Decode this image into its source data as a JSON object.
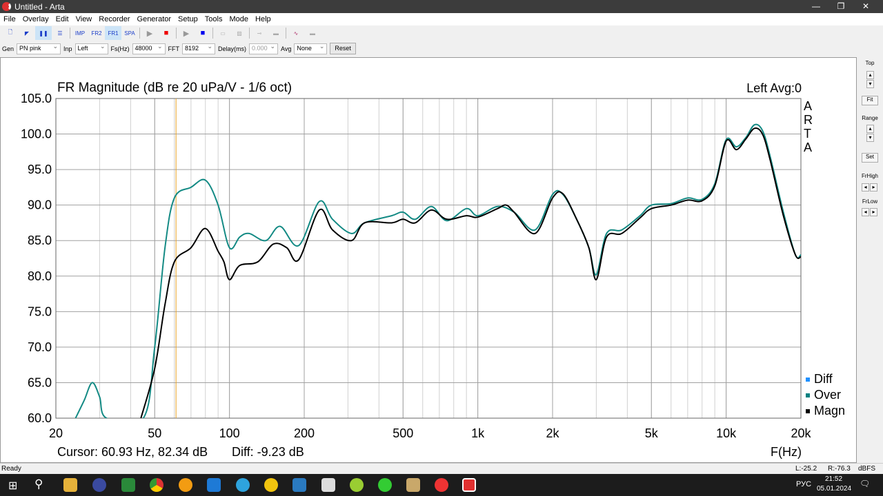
{
  "window": {
    "title": "Untitled - Arta",
    "minimize": "—",
    "maximize": "❐",
    "close": "✕"
  },
  "menu": [
    "File",
    "Overlay",
    "Edit",
    "View",
    "Recorder",
    "Generator",
    "Setup",
    "Tools",
    "Mode",
    "Help"
  ],
  "toolbar": {
    "imp": "IMP",
    "fr2": "FR2",
    "fr1": "FR1",
    "spa": "SPA"
  },
  "params": {
    "gen_label": "Gen",
    "gen": "PN pink",
    "inp_label": "Inp",
    "inp": "Left",
    "fs_label": "Fs(Hz)",
    "fs": "48000",
    "fft_label": "FFT",
    "fft": "8192",
    "delay_label": "Delay(ms)",
    "delay": "0.000",
    "avg_label": "Avg",
    "avg": "None",
    "reset": "Reset"
  },
  "right_panel": {
    "top": "Top",
    "fit": "Fit",
    "range": "Range",
    "set": "Set",
    "frhigh": "FrHigh",
    "frlow": "FrLow"
  },
  "chart_data": {
    "type": "line",
    "title": "FR Magnitude (dB re 20 uPa/V - 1/6 oct)",
    "channel_info": "Left  Avg:0",
    "watermark": "ARTA",
    "xlabel": "F(Hz)",
    "xscale": "log",
    "xlim": [
      20,
      20000
    ],
    "xticks": [
      20,
      50,
      100,
      200,
      500,
      1000,
      2000,
      5000,
      10000,
      20000
    ],
    "xtick_labels": [
      "20",
      "50",
      "100",
      "200",
      "500",
      "1k",
      "2k",
      "5k",
      "10k",
      "20k"
    ],
    "ylim": [
      60,
      105
    ],
    "yticks": [
      "105.0",
      "100.0",
      "95.0",
      "90.0",
      "85.0",
      "80.0",
      "75.0",
      "70.0",
      "65.0",
      "60.0"
    ],
    "grid": true,
    "legend": [
      {
        "name": "Diff",
        "color": "#1e90ff"
      },
      {
        "name": "Over",
        "color": "#008080"
      },
      {
        "name": "Magn",
        "color": "#000000"
      }
    ],
    "legend_position": "bottom-right",
    "cursor_freq": 60.93,
    "cursor_text": "Cursor: 60.93 Hz, 82.34 dB",
    "diff_text": "Diff: -9.23 dB",
    "series": [
      {
        "name": "Over",
        "color": "#138a84",
        "x": [
          24,
          26,
          28,
          30,
          32,
          45,
          50,
          55,
          60,
          70,
          80,
          90,
          100,
          110,
          120,
          140,
          160,
          190,
          230,
          260,
          310,
          350,
          450,
          500,
          560,
          650,
          750,
          900,
          1000,
          1200,
          1400,
          1700,
          2000,
          2200,
          2500,
          2800,
          3000,
          3300,
          3800,
          4500,
          5000,
          6000,
          7000,
          8000,
          9000,
          10000,
          11000,
          12000,
          13000,
          14000,
          15000,
          17000,
          19000,
          20000
        ],
        "y": [
          60,
          62.5,
          65,
          63,
          60,
          60,
          70,
          84,
          91,
          92.5,
          93.5,
          90,
          84,
          85.5,
          86,
          85,
          87,
          84.3,
          90.5,
          88,
          86,
          87.5,
          88.5,
          89,
          88,
          89.8,
          87.8,
          89.5,
          88.5,
          89.8,
          89,
          86.5,
          91.5,
          91.5,
          88,
          84,
          80.2,
          86,
          86.5,
          88.5,
          90,
          90.2,
          91,
          90.8,
          93,
          99.2,
          98.2,
          99.5,
          101.3,
          100.5,
          97,
          89,
          83,
          83
        ]
      },
      {
        "name": "Magn",
        "color": "#000000",
        "x": [
          44,
          50,
          55,
          60,
          70,
          80,
          90,
          95,
          100,
          110,
          130,
          150,
          170,
          190,
          230,
          260,
          310,
          350,
          450,
          500,
          560,
          650,
          750,
          900,
          1000,
          1200,
          1300,
          1400,
          1700,
          2000,
          2200,
          2500,
          2800,
          3000,
          3300,
          3800,
          4500,
          5000,
          6000,
          7000,
          8000,
          9000,
          10000,
          11000,
          12000,
          13000,
          14000,
          15000,
          17000,
          19000,
          20000
        ],
        "y": [
          60,
          67,
          76,
          82,
          84,
          86.7,
          83.5,
          82,
          79.5,
          81.5,
          82,
          84.5,
          84,
          82.3,
          89.3,
          86.5,
          85,
          87.5,
          87.5,
          88,
          87.5,
          89.3,
          88,
          88.5,
          88.3,
          89.5,
          90,
          89,
          86,
          91,
          91.6,
          88,
          84,
          79.5,
          85.5,
          86,
          88.2,
          89.5,
          90,
          90.7,
          90.6,
          92.7,
          99,
          97.8,
          99.3,
          100.8,
          100,
          96.5,
          88.5,
          83,
          82.7
        ]
      }
    ]
  },
  "status": {
    "ready": "Ready",
    "l": "L:-25.2",
    "r": "R:-76.3",
    "unit": "dBFS"
  },
  "taskbar": {
    "lang": "РУС",
    "time": "21:52",
    "date": "05.01.2024",
    "notif": "1"
  }
}
